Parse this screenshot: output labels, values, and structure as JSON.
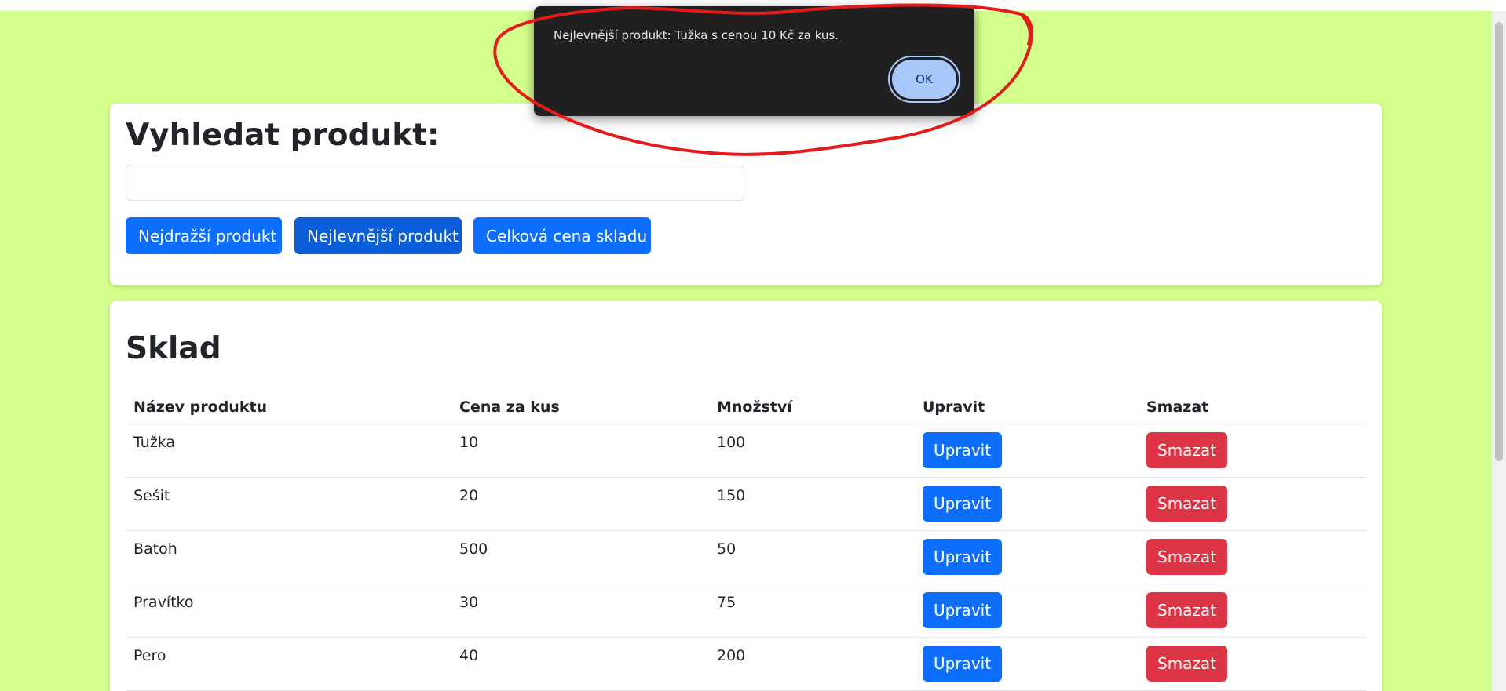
{
  "search": {
    "heading": "Vyhledat produkt:",
    "input_value": "",
    "buttons": {
      "most_expensive": "Nejdražší produkt",
      "cheapest": "Nejlevnější produkt",
      "total_value": "Celková cena skladu"
    }
  },
  "stock": {
    "heading": "Sklad",
    "columns": [
      "Název produktu",
      "Cena za kus",
      "Množství",
      "Upravit",
      "Smazat"
    ],
    "rows": [
      {
        "name": "Tužka",
        "price": "10",
        "quantity": "100",
        "edit": "Upravit",
        "delete": "Smazat"
      },
      {
        "name": "Sešit",
        "price": "20",
        "quantity": "150",
        "edit": "Upravit",
        "delete": "Smazat"
      },
      {
        "name": "Batoh",
        "price": "500",
        "quantity": "50",
        "edit": "Upravit",
        "delete": "Smazat"
      },
      {
        "name": "Pravítko",
        "price": "30",
        "quantity": "75",
        "edit": "Upravit",
        "delete": "Smazat"
      },
      {
        "name": "Pero",
        "price": "40",
        "quantity": "200",
        "edit": "Upravit",
        "delete": "Smazat"
      }
    ]
  },
  "alert": {
    "message": "Nejlevnější produkt: Tužka s cenou 10 Kč za kus.",
    "ok_label": "OK"
  },
  "colors": {
    "page_background": "#d4ff8c",
    "primary": "#0d6efd",
    "danger": "#dc3545",
    "dialog_background": "#202020",
    "dialog_button": "#a8c7fa",
    "annotation": "#e31b1b"
  }
}
